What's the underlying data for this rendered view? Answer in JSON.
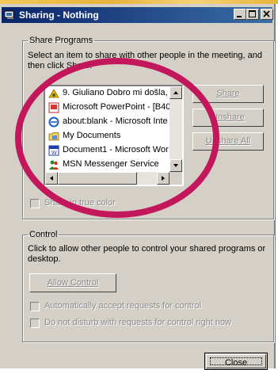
{
  "window": {
    "title": "Sharing - Nothing",
    "controls": {
      "minimize": "minimize",
      "maximize": "maximize",
      "close": "close"
    }
  },
  "share_programs": {
    "legend": "Share Programs",
    "instruction": "Select an item to share with other people in the meeting, and then click Share.",
    "items": [
      {
        "label": "9. Giuliano Dobro mi došla,",
        "icon": "media-player-icon"
      },
      {
        "label": "Microsoft PowerPoint - [B40",
        "icon": "powerpoint-icon"
      },
      {
        "label": "about:blank - Microsoft Inte",
        "icon": "internet-explorer-icon"
      },
      {
        "label": "My Documents",
        "icon": "folder-icon"
      },
      {
        "label": "Document1 - Microsoft Wor",
        "icon": "word-icon"
      },
      {
        "label": "MSN Messenger Service",
        "icon": "messenger-icon"
      }
    ],
    "buttons": {
      "share": "Share",
      "unshare": "Unshare",
      "unshare_all": "Unshare All"
    },
    "true_color_label": "Share in true color"
  },
  "control": {
    "legend": "Control",
    "instruction": "Click to allow other people to control your shared programs or desktop.",
    "allow_button": "Allow Control",
    "auto_accept_label": "Automatically accept requests for control",
    "do_not_disturb_label": "Do not disturb with requests for control right now"
  },
  "close_button": "Close",
  "colors": {
    "title_start": "#0a246a",
    "title_end": "#3a6ea5",
    "annotation": "#c2185b",
    "face": "#d4d0c8"
  }
}
